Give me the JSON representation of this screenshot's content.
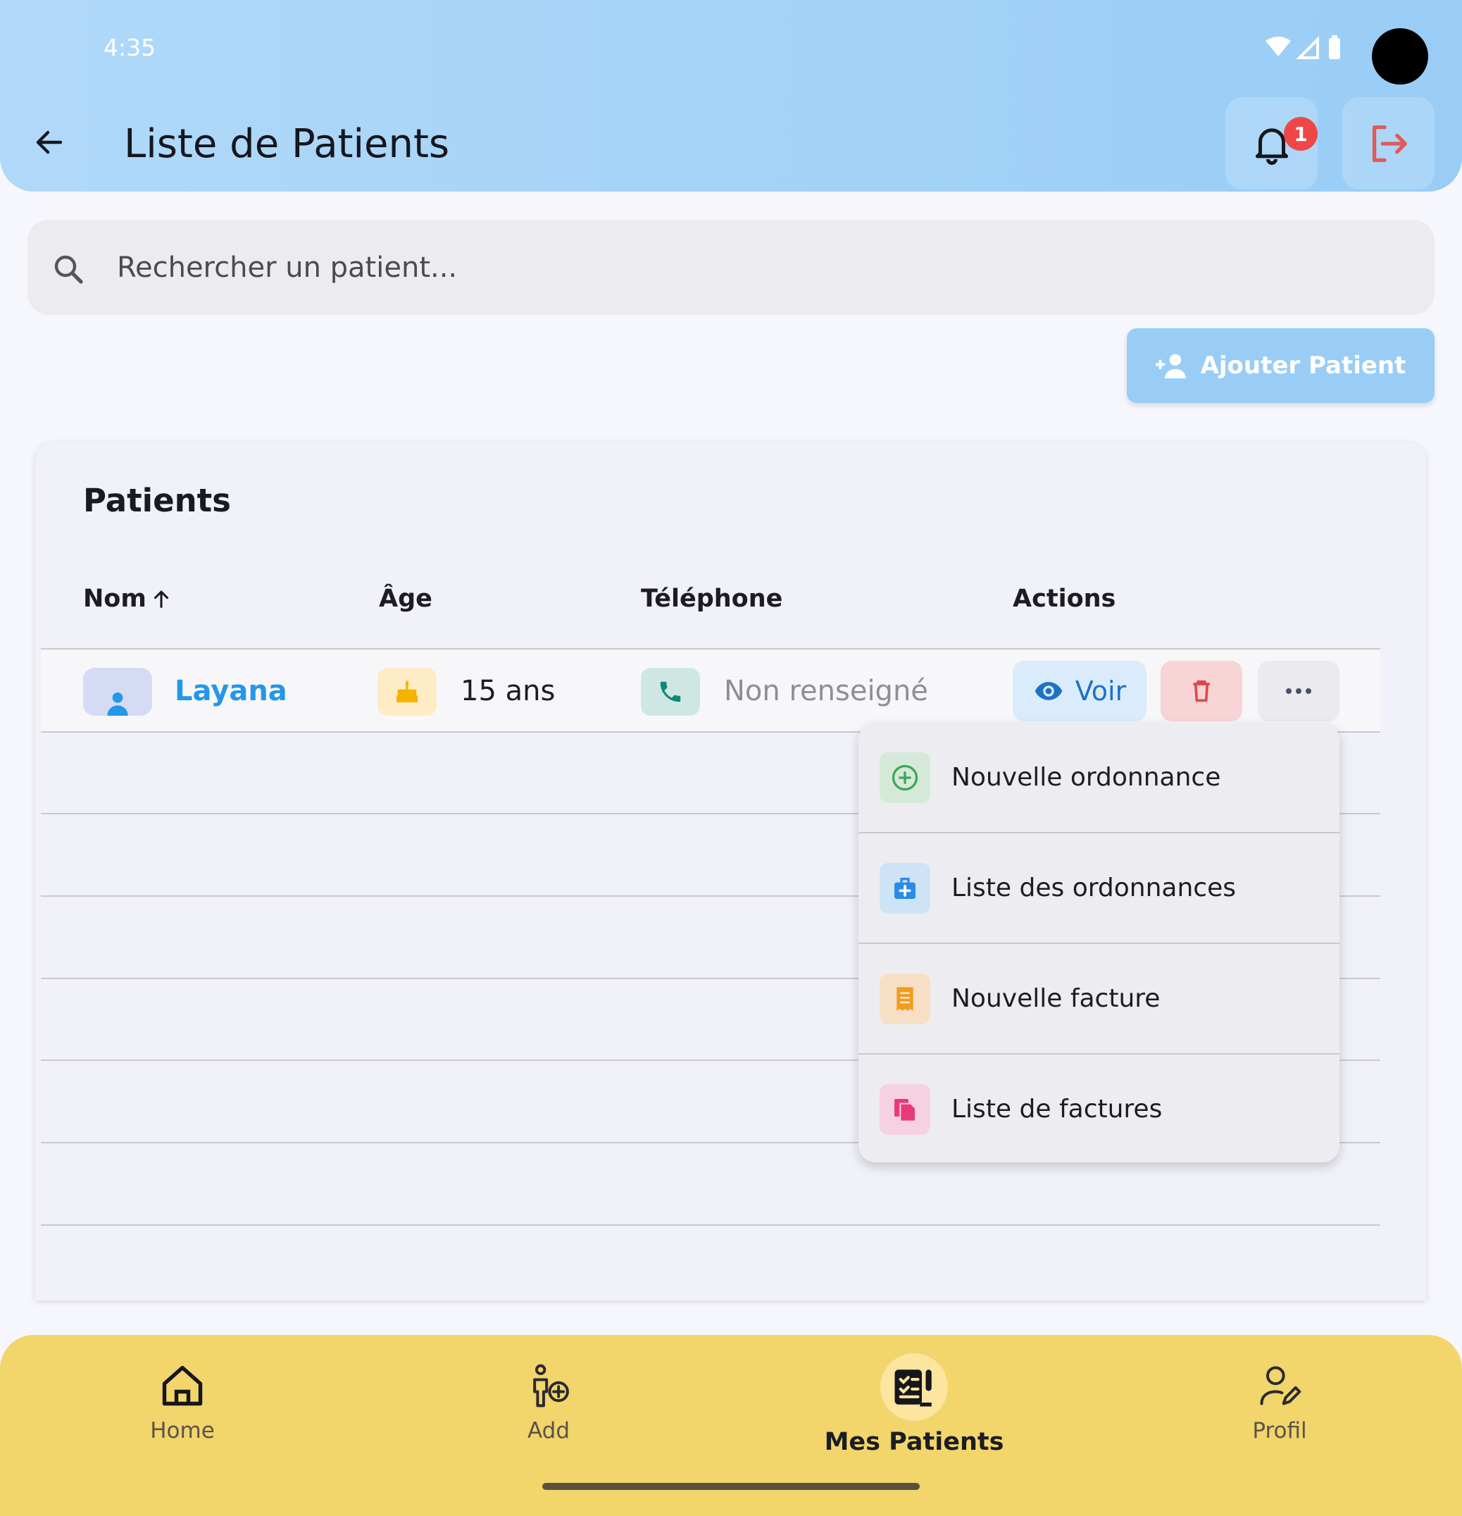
{
  "status_bar": {
    "time": "4:35"
  },
  "header": {
    "title": "Liste de Patients",
    "notification_count": "1"
  },
  "search": {
    "placeholder": "Rechercher un patient..."
  },
  "add_patient": {
    "label": "Ajouter Patient"
  },
  "patients_card": {
    "title": "Patients",
    "columns": {
      "name": "Nom",
      "age": "Âge",
      "phone": "Téléphone",
      "actions": "Actions"
    },
    "rows": [
      {
        "name": "Layana",
        "age": "15 ans",
        "phone": "Non renseigné",
        "view_label": "Voir"
      }
    ]
  },
  "actions_menu": {
    "items": [
      {
        "label": "Nouvelle ordonnance",
        "icon": "add-circle-icon"
      },
      {
        "label": "Liste des ordonnances",
        "icon": "medical-kit-icon"
      },
      {
        "label": "Nouvelle facture",
        "icon": "receipt-icon"
      },
      {
        "label": "Liste de factures",
        "icon": "documents-icon"
      }
    ]
  },
  "bottom_nav": {
    "items": [
      {
        "label": "Home",
        "icon": "home-icon"
      },
      {
        "label": "Add",
        "icon": "add-person-icon"
      },
      {
        "label": "Mes Patients",
        "icon": "patients-list-icon",
        "active": true
      },
      {
        "label": "Profil",
        "icon": "profile-edit-icon"
      }
    ]
  },
  "colors": {
    "header_gradient_start": "#b0d9f9",
    "header_gradient_end": "#99cdf6",
    "accent_blue": "#2497e8",
    "danger": "#ef4747",
    "nav_background": "#f2d56b"
  }
}
